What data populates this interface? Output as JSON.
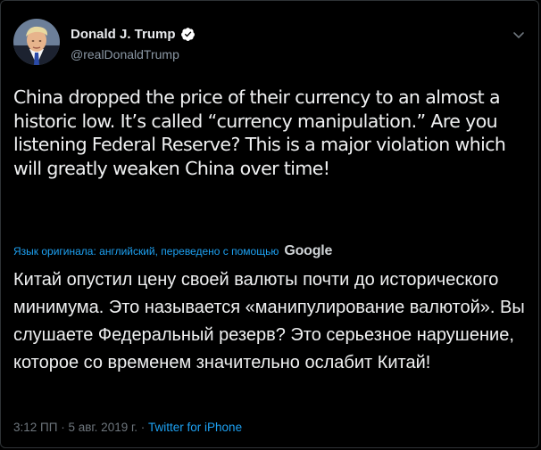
{
  "author": {
    "display_name": "Donald J. Trump",
    "handle": "@realDonaldTrump",
    "verified": true
  },
  "tweet": {
    "text": "China dropped the price of their currency to an almost a historic low. It’s called “currency manipulation.” Are you listening Federal Reserve? This is a major violation which will greatly weaken China over time!"
  },
  "translation": {
    "label": "Язык оригинала: английский, переведено с помощью",
    "provider": "Google",
    "text": "Китай опустил цену своей валюты почти до исторического минимума. Это называется «манипулирование валютой». Вы слушаете Федеральный резерв? Это серьезное нарушение, которое со временем значительно ослабит Китай!"
  },
  "meta": {
    "time": "3:12 ПП",
    "separator": "·",
    "date": "5 авг. 2019 г.",
    "source": "Twitter for iPhone"
  },
  "colors": {
    "background": "#000000",
    "text": "#f0f1f2",
    "link": "#1da1f2",
    "secondary": "#6e767d",
    "verified_badge": "#ffffff"
  },
  "icons": {
    "verified": "verified-badge-icon",
    "menu": "chevron-down-icon"
  }
}
